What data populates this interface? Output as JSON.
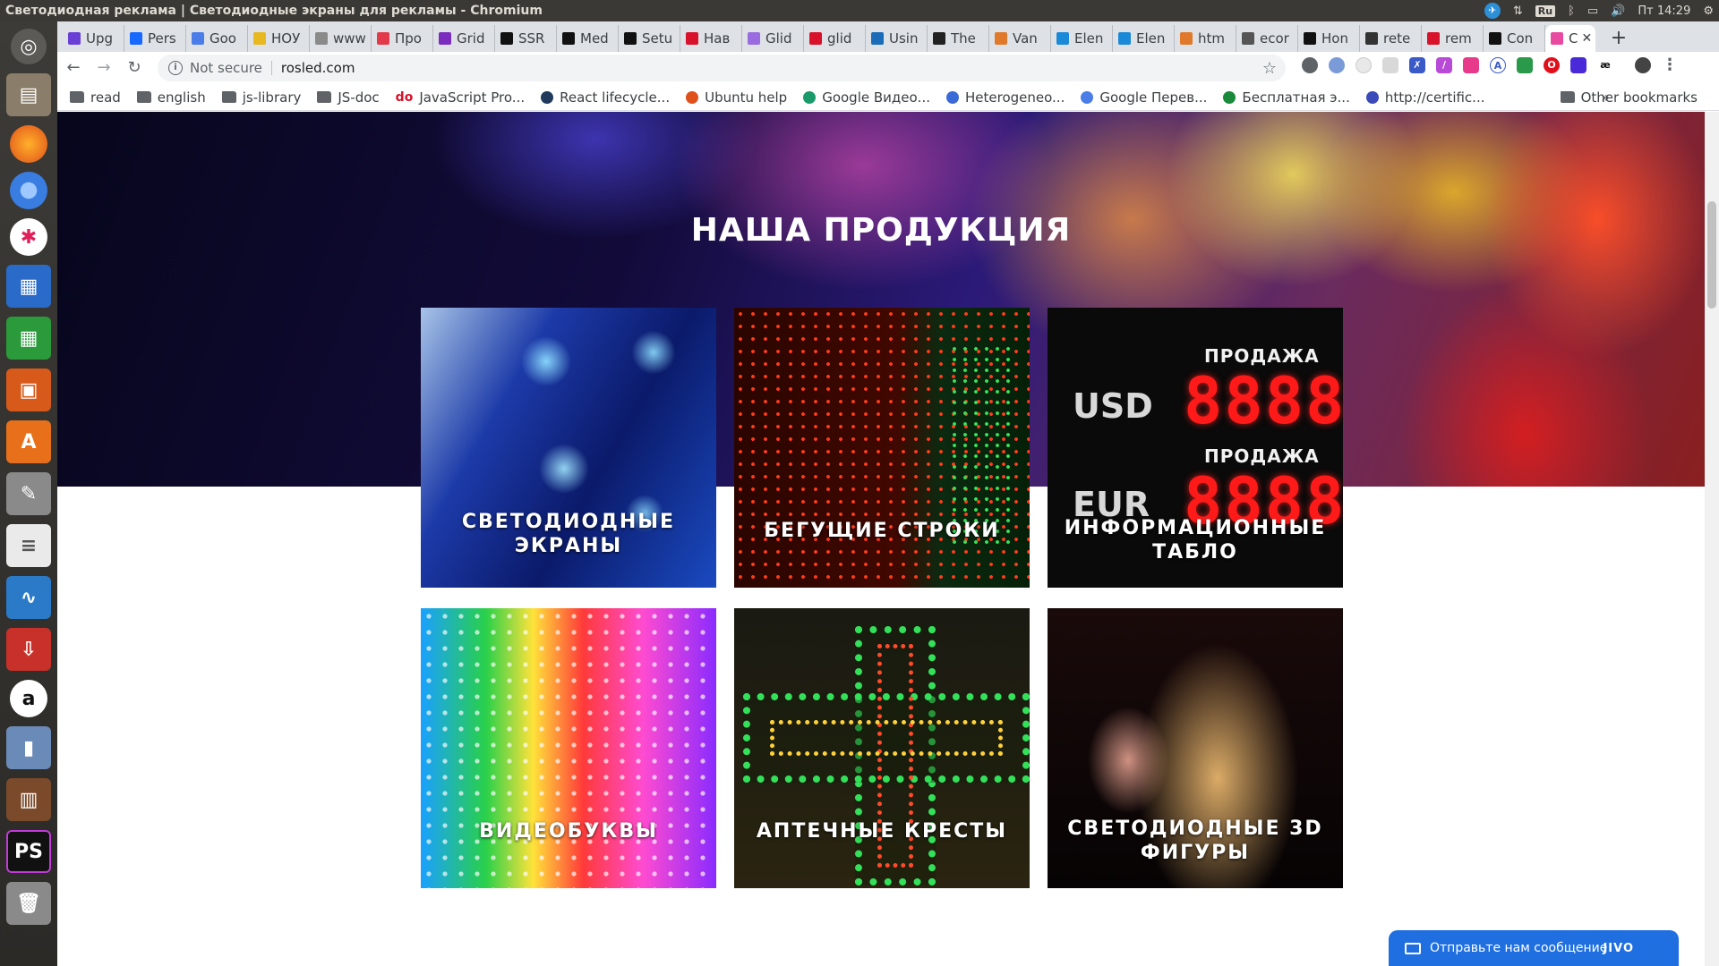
{
  "system": {
    "window_title": "Светодиодная реклама | Светодиодные экраны для рекламы - Chromium",
    "keyboard_layout": "Ru",
    "clock": "Пт 14:29"
  },
  "tabs": [
    {
      "label": "Upg",
      "color": "#6a3fd6"
    },
    {
      "label": "Pers",
      "color": "#1769ff"
    },
    {
      "label": "Goo",
      "color": "#4a7de8"
    },
    {
      "label": "НОУ",
      "color": "#e8b820"
    },
    {
      "label": "www",
      "color": "#8a8a8a"
    },
    {
      "label": "Про",
      "color": "#e23a4a"
    },
    {
      "label": "Grid",
      "color": "#7b2cbf"
    },
    {
      "label": "SSR",
      "color": "#111111"
    },
    {
      "label": "Med",
      "color": "#111111"
    },
    {
      "label": "Setu",
      "color": "#111111"
    },
    {
      "label": "Нав",
      "color": "#d8122a"
    },
    {
      "label": "Glid",
      "color": "#9a6ae0"
    },
    {
      "label": "glid",
      "color": "#d8122a"
    },
    {
      "label": "Usin",
      "color": "#1a6bb8"
    },
    {
      "label": "The",
      "color": "#222222"
    },
    {
      "label": "Van",
      "color": "#e07a2a"
    },
    {
      "label": "Elen",
      "color": "#1a8ad8"
    },
    {
      "label": "Elen",
      "color": "#1a8ad8"
    },
    {
      "label": "htm",
      "color": "#e07a2a"
    },
    {
      "label": "ecor",
      "color": "#555555"
    },
    {
      "label": "Hon",
      "color": "#111111"
    },
    {
      "label": "rete",
      "color": "#333333"
    },
    {
      "label": "rem",
      "color": "#d8122a"
    },
    {
      "label": "Con",
      "color": "#111111"
    },
    {
      "label": "С",
      "color": "#e84aa0"
    }
  ],
  "toolbar": {
    "security_label": "Not secure",
    "url": "rosled.com"
  },
  "bookmarks": [
    {
      "label": "read",
      "kind": "folder"
    },
    {
      "label": "english",
      "kind": "folder"
    },
    {
      "label": "js-library",
      "kind": "folder"
    },
    {
      "label": "JS-doc",
      "kind": "folder"
    },
    {
      "label": "JavaScript Pro...",
      "kind": "site",
      "icon_text": "do",
      "color": "#d8122a"
    },
    {
      "label": "React lifecycle...",
      "kind": "site",
      "color": "#1f3a5a"
    },
    {
      "label": "Ubuntu help",
      "kind": "site",
      "color": "#e0501a"
    },
    {
      "label": "Google Видео...",
      "kind": "site",
      "color": "#1a9a6a"
    },
    {
      "label": "Heterogeneo...",
      "kind": "site",
      "color": "#3a6ad8"
    },
    {
      "label": "Google Перев...",
      "kind": "site",
      "color": "#4a7de8"
    },
    {
      "label": "Бесплатная э...",
      "kind": "site",
      "color": "#1a8a3a"
    },
    {
      "label": "http://certific...",
      "kind": "site",
      "color": "#3a4ab8"
    }
  ],
  "bookmarks_more": "»",
  "other_bookmarks": "Other bookmarks",
  "page": {
    "section_title": "НАША ПРОДУКЦИЯ",
    "products": [
      {
        "label": "СВЕТОДИОДНЫЕ\nЭКРАНЫ"
      },
      {
        "label": "БЕГУЩИЕ СТРОКИ"
      },
      {
        "label": "ИНФОРМАЦИОННЫЕ\nТАБЛО"
      },
      {
        "label": "ВИДЕОБУКВЫ"
      },
      {
        "label": "АПТЕЧНЫЕ КРЕСТЫ"
      },
      {
        "label": "СВЕТОДИОДНЫЕ 3D\nФИГУРЫ"
      }
    ],
    "board": {
      "sale_1": "ПРОДАЖА",
      "sale_2": "ПРОДАЖА",
      "currency_1": "USD",
      "currency_2": "EUR",
      "digits_1": "8888",
      "digits_2": "8888"
    },
    "chat": {
      "message": "Отправьте нам сообщение",
      "brand": "JIVO"
    }
  }
}
